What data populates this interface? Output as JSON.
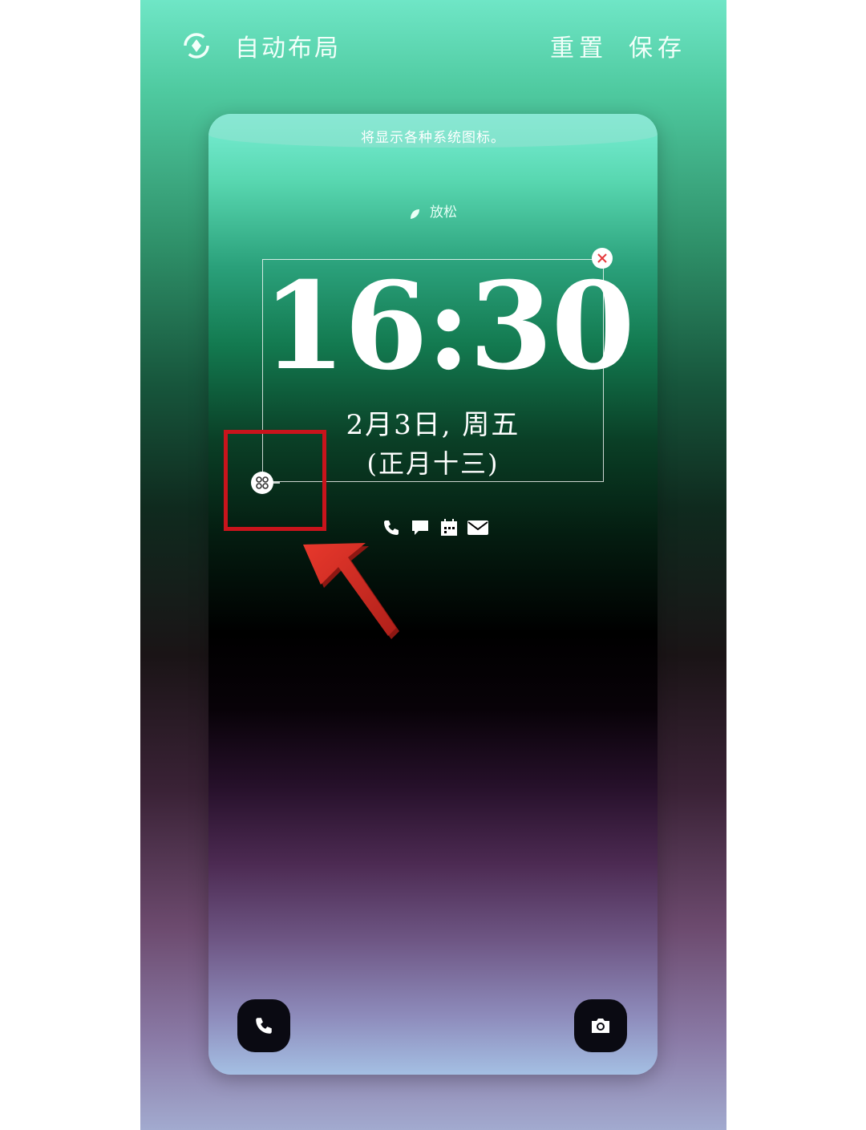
{
  "topbar": {
    "auto_layout_label": "自动布局",
    "reset_label": "重置",
    "save_label": "保存",
    "auto_layout_icon": "rotate-icon"
  },
  "lockscreen": {
    "notice": "将显示各种系统图标。",
    "focus_mode": "放松",
    "time": "16:30",
    "date": "2月3日, 周五",
    "lunar_date": "(正月十三)",
    "notification_icons": [
      "phone-icon",
      "message-icon",
      "calendar-icon",
      "mail-icon"
    ],
    "shortcuts": [
      "phone-icon",
      "camera-icon"
    ]
  },
  "annotation": {
    "highlight_color": "#c9141c",
    "arrow_color": "#d42a22"
  }
}
